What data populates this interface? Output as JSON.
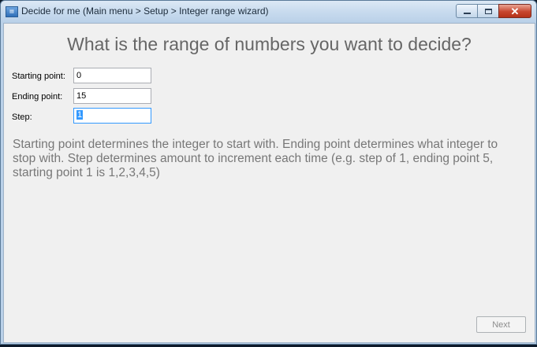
{
  "window": {
    "title": "Decide for me (Main menu > Setup > Integer range wizard)",
    "icon": "app-icon",
    "controls": [
      "minimize-icon",
      "maximize-icon",
      "close-icon"
    ]
  },
  "main": {
    "heading": "What is the range of numbers you want to decide?",
    "fields": [
      {
        "label": "Starting point:",
        "value": "0"
      },
      {
        "label": "Ending point:",
        "value": "15"
      },
      {
        "label": "Step:",
        "value": "1"
      }
    ],
    "description": "Starting point determines the integer to start with. Ending point determines what integer to stop with. Step determines amount to increment each time (e.g. step of 1, ending point 5, starting point 1 is 1,2,3,4,5)",
    "next_label": "Next"
  }
}
